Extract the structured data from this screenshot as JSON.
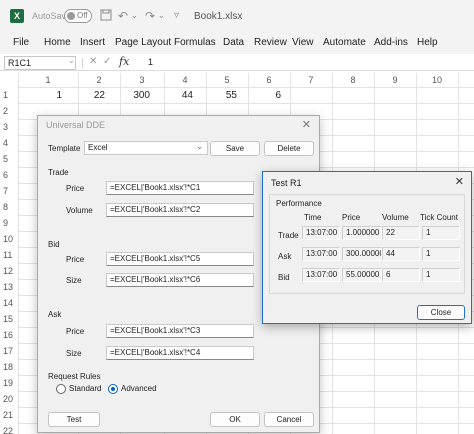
{
  "titlebar": {
    "autosave_label": "AutoSave",
    "autosave_state": "Off",
    "doc_title": "Book1.xlsx",
    "logo_icon": "excel-logo-icon",
    "accent": "#1d6f42"
  },
  "menu": [
    "File",
    "Home",
    "Insert",
    "Page Layout",
    "Formulas",
    "Data",
    "Review",
    "View",
    "Automate",
    "Add-ins",
    "Help"
  ],
  "formula_bar": {
    "name_box": "R1C1",
    "fx": "fx",
    "value": "1"
  },
  "grid": {
    "columns": [
      "1",
      "2",
      "3",
      "4",
      "5",
      "6",
      "7",
      "8",
      "9",
      "10"
    ],
    "rows": [
      "1",
      "2",
      "3",
      "4",
      "5",
      "6",
      "7",
      "8",
      "9",
      "10",
      "11",
      "12",
      "13",
      "14",
      "15",
      "16",
      "17",
      "18",
      "19",
      "20",
      "21",
      "22"
    ],
    "row1_values": [
      "1",
      "22",
      "300",
      "44",
      "55",
      "6"
    ]
  },
  "dde_dialog": {
    "title": "Universal DDE",
    "template_label": "Template",
    "template_value": "Excel",
    "save_label": "Save",
    "delete_label": "Delete",
    "trade": {
      "heading": "Trade",
      "price_label": "Price",
      "price_value": "=EXCEL|'Book1.xlsx'!*C1",
      "volume_label": "Volume",
      "volume_value": "=EXCEL|'Book1.xlsx'!*C2"
    },
    "bid": {
      "heading": "Bid",
      "price_label": "Price",
      "price_value": "=EXCEL|'Book1.xlsx'!*C5",
      "size_label": "Size",
      "size_value": "=EXCEL|'Book1.xlsx'!*C6"
    },
    "ask": {
      "heading": "Ask",
      "price_label": "Price",
      "price_value": "=EXCEL|'Book1.xlsx'!*C3",
      "size_label": "Size",
      "size_value": "=EXCEL|'Book1.xlsx'!*C4"
    },
    "request_rules_label": "Request Rules",
    "standard_label": "Standard",
    "advanced_label": "Advanced",
    "selected_rule": "Advanced",
    "test_label": "Test",
    "ok_label": "OK",
    "cancel_label": "Cancel"
  },
  "test_dialog": {
    "title": "Test R1",
    "section": "Performance",
    "headers": [
      "Time",
      "Price",
      "Volume",
      "Tick Count"
    ],
    "rows": [
      {
        "label": "Trade",
        "time": "13:07:00",
        "price": "1.000000",
        "volume": "22",
        "ticks": "1"
      },
      {
        "label": "Ask",
        "time": "13:07:00",
        "price": "300.00000",
        "volume": "44",
        "ticks": "1"
      },
      {
        "label": "Bid",
        "time": "13:07:00",
        "price": "55.00000",
        "volume": "6",
        "ticks": "1"
      }
    ],
    "close_label": "Close",
    "accent": "#1e6fd0"
  }
}
